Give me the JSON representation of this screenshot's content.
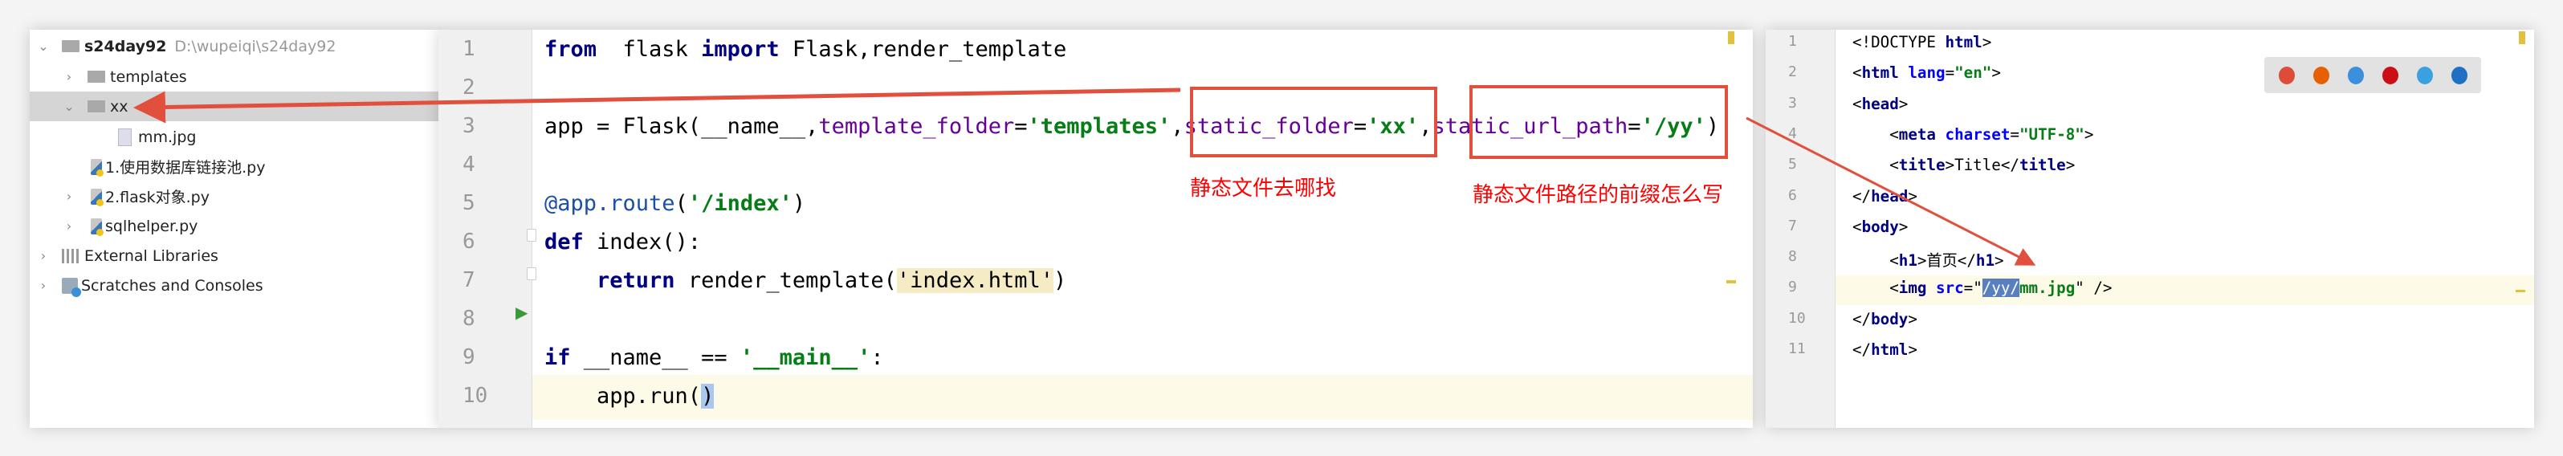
{
  "project_tree": {
    "root": {
      "name": "s24day92",
      "path": "D:\\wupeiqi\\s24day92"
    },
    "items": [
      {
        "label": "templates",
        "type": "folder",
        "expanded": false
      },
      {
        "label": "xx",
        "type": "folder",
        "expanded": true,
        "selected": true
      },
      {
        "label": "mm.jpg",
        "type": "image"
      },
      {
        "label": "1.使用数据库链接池.py",
        "type": "python"
      },
      {
        "label": "2.flask对象.py",
        "type": "python"
      },
      {
        "label": "sqlhelper.py",
        "type": "python"
      },
      {
        "label": "External Libraries",
        "type": "library"
      },
      {
        "label": "Scratches and Consoles",
        "type": "scratches"
      }
    ]
  },
  "python_editor": {
    "line_numbers": [
      "1",
      "2",
      "3",
      "4",
      "5",
      "6",
      "7",
      "8",
      "9",
      "10"
    ],
    "current_line": "10",
    "lines": [
      [
        [
          "kw",
          "from"
        ],
        [
          "",
          "  flask "
        ],
        [
          "kw",
          "import"
        ],
        [
          "",
          " Flask,render_template"
        ]
      ],
      [],
      [
        [
          "",
          "app = Flask(__name__,"
        ],
        [
          "kwarg",
          "template_folder"
        ],
        [
          "",
          "="
        ],
        [
          "str",
          "'templates'"
        ],
        [
          "",
          ","
        ],
        [
          "kwarg",
          "static_folder"
        ],
        [
          "",
          "="
        ],
        [
          "str",
          "'xx'"
        ],
        [
          "",
          ","
        ],
        [
          "kwarg",
          "static_url_path"
        ],
        [
          "",
          "="
        ],
        [
          "str",
          "'/yy'"
        ],
        [
          "",
          ")"
        ]
      ],
      [],
      [
        [
          "dec",
          "@app.route"
        ],
        [
          "",
          "("
        ],
        [
          "str",
          "'/index'"
        ],
        [
          "",
          ")"
        ]
      ],
      [
        [
          "kw",
          "def"
        ],
        [
          "",
          " index():"
        ]
      ],
      [
        [
          "",
          "    "
        ],
        [
          "kw",
          "return"
        ],
        [
          "",
          " render_template("
        ],
        [
          "match",
          "'index.html'"
        ],
        [
          "",
          ")"
        ]
      ],
      [],
      [
        [
          "kw",
          "if"
        ],
        [
          "",
          " __name__ == "
        ],
        [
          "str",
          "'__main__'"
        ],
        [
          "",
          ":"
        ]
      ],
      [
        [
          "",
          "    app.run("
        ],
        [
          "caret-bg",
          ")"
        ]
      ]
    ]
  },
  "annotations": {
    "static_folder_note": "静态文件去哪找",
    "static_url_path_note": "静态文件路径的前缀怎么写",
    "color": "#ff0000"
  },
  "html_editor": {
    "line_numbers": [
      "1",
      "2",
      "3",
      "4",
      "5",
      "6",
      "7",
      "8",
      "9",
      "10",
      "11"
    ],
    "current_line": "9",
    "lines": [
      [
        [
          "",
          "<!DOCTYPE "
        ],
        [
          "tag",
          "html"
        ],
        [
          "",
          ">"
        ]
      ],
      [
        [
          "",
          "<"
        ],
        [
          "tag",
          "html"
        ],
        [
          "",
          " "
        ],
        [
          "attr",
          "lang"
        ],
        [
          "",
          "="
        ],
        [
          "val",
          "\"en\""
        ],
        [
          "",
          ">"
        ]
      ],
      [
        [
          "",
          "<"
        ],
        [
          "tag",
          "head"
        ],
        [
          "",
          ">"
        ]
      ],
      [
        [
          "",
          "    <"
        ],
        [
          "tag",
          "meta"
        ],
        [
          "",
          " "
        ],
        [
          "attr",
          "charset"
        ],
        [
          "",
          "="
        ],
        [
          "val",
          "\"UTF-8\""
        ],
        [
          "",
          ">"
        ]
      ],
      [
        [
          "",
          "    <"
        ],
        [
          "tag",
          "title"
        ],
        [
          "",
          ">Title</"
        ],
        [
          "tag",
          "title"
        ],
        [
          "",
          ">"
        ]
      ],
      [
        [
          "",
          "</"
        ],
        [
          "tag",
          "head"
        ],
        [
          "",
          ">"
        ]
      ],
      [
        [
          "",
          "<"
        ],
        [
          "tag",
          "body"
        ],
        [
          "",
          ">"
        ]
      ],
      [
        [
          "",
          "    <"
        ],
        [
          "tag",
          "h1"
        ],
        [
          "",
          ">首页</"
        ],
        [
          "tag",
          "h1"
        ],
        [
          "",
          ">"
        ]
      ],
      [
        [
          "",
          "    <"
        ],
        [
          "tag",
          "img"
        ],
        [
          "",
          " "
        ],
        [
          "attr",
          "src"
        ],
        [
          "",
          "=\""
        ],
        [
          "sel-text",
          "/yy/"
        ],
        [
          "val",
          "mm.jpg"
        ],
        [
          "",
          "\" />"
        ]
      ],
      [
        [
          "",
          "</"
        ],
        [
          "tag",
          "body"
        ],
        [
          "",
          ">"
        ]
      ],
      [
        [
          "",
          "</"
        ],
        [
          "tag",
          "html"
        ],
        [
          "",
          ">"
        ]
      ]
    ],
    "browser_icons": [
      "chrome-icon",
      "firefox-icon",
      "safari-icon",
      "opera-icon",
      "ie-icon",
      "edge-icon"
    ],
    "browser_colors": [
      "#dd4b39",
      "#e66000",
      "#3b8fdb",
      "#cc0f16",
      "#3aa0e0",
      "#1f6fc5"
    ]
  }
}
